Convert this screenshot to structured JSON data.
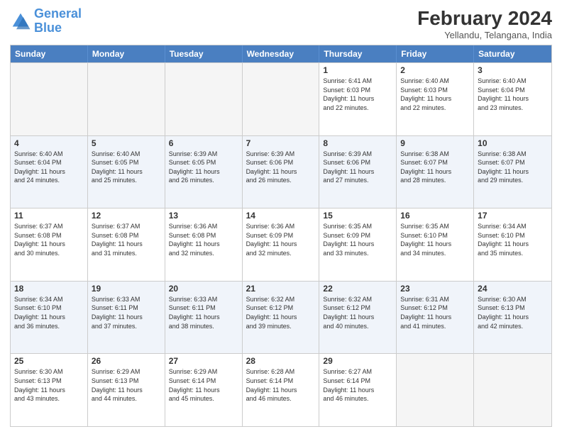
{
  "header": {
    "logo_line1": "General",
    "logo_line2": "Blue",
    "main_title": "February 2024",
    "subtitle": "Yellandu, Telangana, India"
  },
  "weekdays": [
    "Sunday",
    "Monday",
    "Tuesday",
    "Wednesday",
    "Thursday",
    "Friday",
    "Saturday"
  ],
  "weeks": [
    [
      {
        "day": "",
        "info": ""
      },
      {
        "day": "",
        "info": ""
      },
      {
        "day": "",
        "info": ""
      },
      {
        "day": "",
        "info": ""
      },
      {
        "day": "1",
        "info": "Sunrise: 6:41 AM\nSunset: 6:03 PM\nDaylight: 11 hours\nand 22 minutes."
      },
      {
        "day": "2",
        "info": "Sunrise: 6:40 AM\nSunset: 6:03 PM\nDaylight: 11 hours\nand 22 minutes."
      },
      {
        "day": "3",
        "info": "Sunrise: 6:40 AM\nSunset: 6:04 PM\nDaylight: 11 hours\nand 23 minutes."
      }
    ],
    [
      {
        "day": "4",
        "info": "Sunrise: 6:40 AM\nSunset: 6:04 PM\nDaylight: 11 hours\nand 24 minutes."
      },
      {
        "day": "5",
        "info": "Sunrise: 6:40 AM\nSunset: 6:05 PM\nDaylight: 11 hours\nand 25 minutes."
      },
      {
        "day": "6",
        "info": "Sunrise: 6:39 AM\nSunset: 6:05 PM\nDaylight: 11 hours\nand 26 minutes."
      },
      {
        "day": "7",
        "info": "Sunrise: 6:39 AM\nSunset: 6:06 PM\nDaylight: 11 hours\nand 26 minutes."
      },
      {
        "day": "8",
        "info": "Sunrise: 6:39 AM\nSunset: 6:06 PM\nDaylight: 11 hours\nand 27 minutes."
      },
      {
        "day": "9",
        "info": "Sunrise: 6:38 AM\nSunset: 6:07 PM\nDaylight: 11 hours\nand 28 minutes."
      },
      {
        "day": "10",
        "info": "Sunrise: 6:38 AM\nSunset: 6:07 PM\nDaylight: 11 hours\nand 29 minutes."
      }
    ],
    [
      {
        "day": "11",
        "info": "Sunrise: 6:37 AM\nSunset: 6:08 PM\nDaylight: 11 hours\nand 30 minutes."
      },
      {
        "day": "12",
        "info": "Sunrise: 6:37 AM\nSunset: 6:08 PM\nDaylight: 11 hours\nand 31 minutes."
      },
      {
        "day": "13",
        "info": "Sunrise: 6:36 AM\nSunset: 6:08 PM\nDaylight: 11 hours\nand 32 minutes."
      },
      {
        "day": "14",
        "info": "Sunrise: 6:36 AM\nSunset: 6:09 PM\nDaylight: 11 hours\nand 32 minutes."
      },
      {
        "day": "15",
        "info": "Sunrise: 6:35 AM\nSunset: 6:09 PM\nDaylight: 11 hours\nand 33 minutes."
      },
      {
        "day": "16",
        "info": "Sunrise: 6:35 AM\nSunset: 6:10 PM\nDaylight: 11 hours\nand 34 minutes."
      },
      {
        "day": "17",
        "info": "Sunrise: 6:34 AM\nSunset: 6:10 PM\nDaylight: 11 hours\nand 35 minutes."
      }
    ],
    [
      {
        "day": "18",
        "info": "Sunrise: 6:34 AM\nSunset: 6:10 PM\nDaylight: 11 hours\nand 36 minutes."
      },
      {
        "day": "19",
        "info": "Sunrise: 6:33 AM\nSunset: 6:11 PM\nDaylight: 11 hours\nand 37 minutes."
      },
      {
        "day": "20",
        "info": "Sunrise: 6:33 AM\nSunset: 6:11 PM\nDaylight: 11 hours\nand 38 minutes."
      },
      {
        "day": "21",
        "info": "Sunrise: 6:32 AM\nSunset: 6:12 PM\nDaylight: 11 hours\nand 39 minutes."
      },
      {
        "day": "22",
        "info": "Sunrise: 6:32 AM\nSunset: 6:12 PM\nDaylight: 11 hours\nand 40 minutes."
      },
      {
        "day": "23",
        "info": "Sunrise: 6:31 AM\nSunset: 6:12 PM\nDaylight: 11 hours\nand 41 minutes."
      },
      {
        "day": "24",
        "info": "Sunrise: 6:30 AM\nSunset: 6:13 PM\nDaylight: 11 hours\nand 42 minutes."
      }
    ],
    [
      {
        "day": "25",
        "info": "Sunrise: 6:30 AM\nSunset: 6:13 PM\nDaylight: 11 hours\nand 43 minutes."
      },
      {
        "day": "26",
        "info": "Sunrise: 6:29 AM\nSunset: 6:13 PM\nDaylight: 11 hours\nand 44 minutes."
      },
      {
        "day": "27",
        "info": "Sunrise: 6:29 AM\nSunset: 6:14 PM\nDaylight: 11 hours\nand 45 minutes."
      },
      {
        "day": "28",
        "info": "Sunrise: 6:28 AM\nSunset: 6:14 PM\nDaylight: 11 hours\nand 46 minutes."
      },
      {
        "day": "29",
        "info": "Sunrise: 6:27 AM\nSunset: 6:14 PM\nDaylight: 11 hours\nand 46 minutes."
      },
      {
        "day": "",
        "info": ""
      },
      {
        "day": "",
        "info": ""
      }
    ]
  ]
}
